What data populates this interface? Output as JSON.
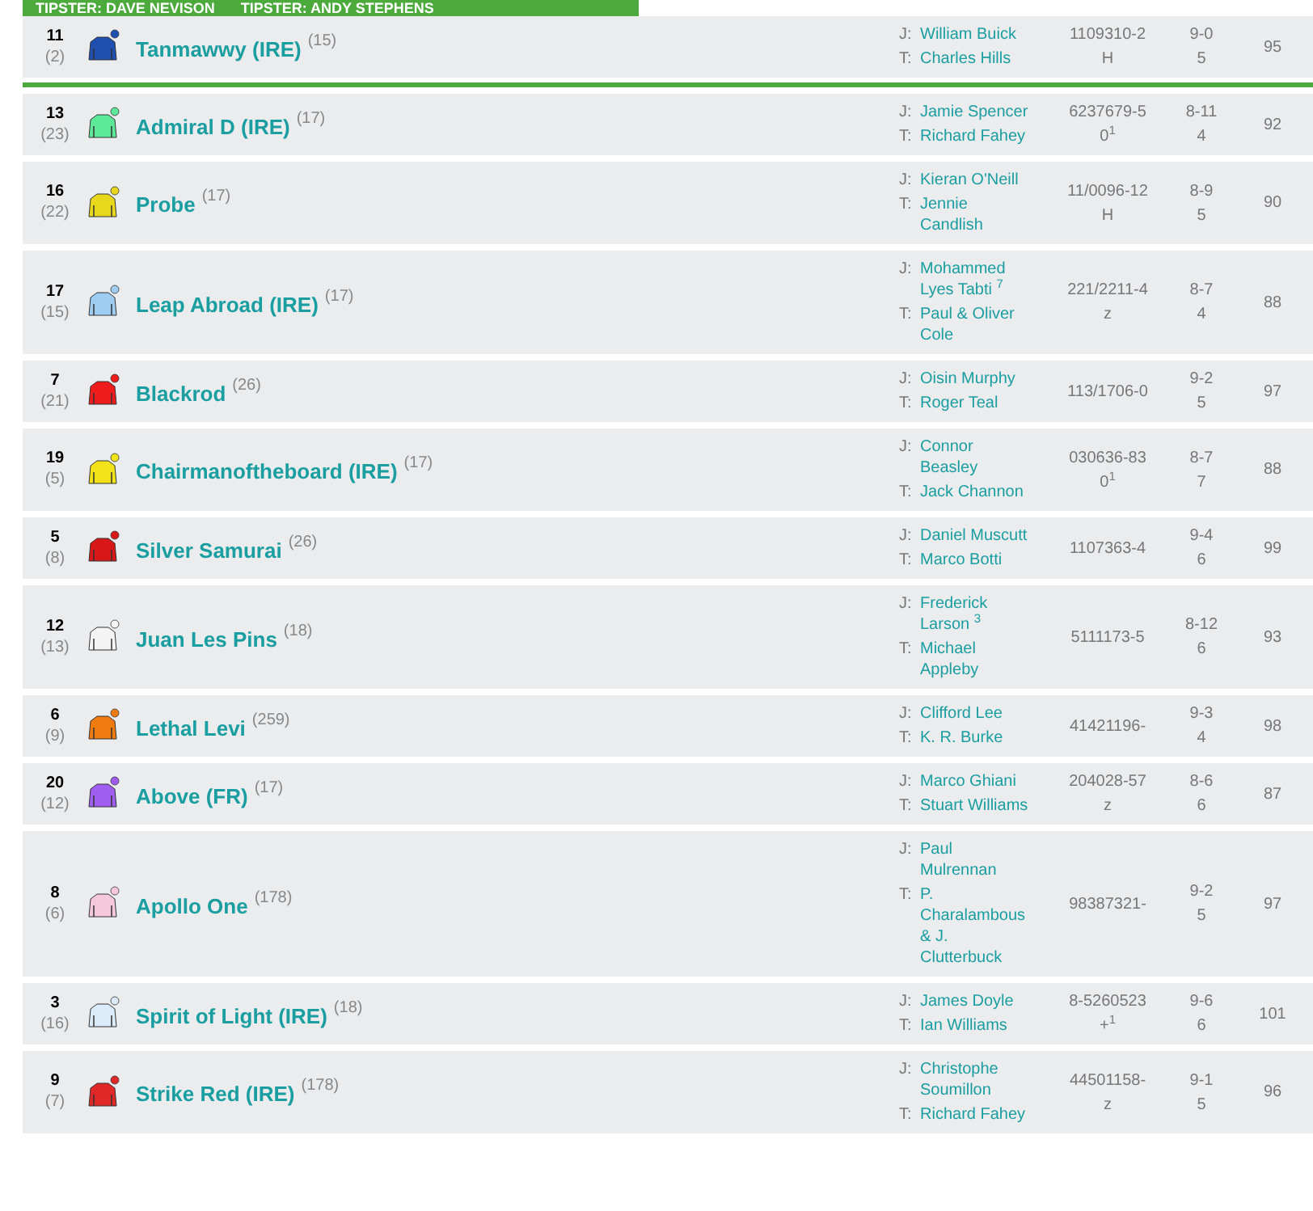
{
  "banner": {
    "tipsters": [
      "TIPSTER: DAVE NEVISON",
      "TIPSTER: ANDY STEPHENS"
    ]
  },
  "runners": [
    {
      "number": "11",
      "draw": "(2)",
      "name": "Tanmawwy (IRE)",
      "days": "(15)",
      "color": "#1f4fb0",
      "jockey_label": "J:",
      "jockey": "William Buick",
      "trainer_label": "T:",
      "trainer": "Charles Hills",
      "form": [
        "1109310-2",
        "H"
      ],
      "weight": "9-0",
      "age": "5",
      "rating": "95"
    },
    {
      "number": "13",
      "draw": "(23)",
      "name": "Admiral D (IRE)",
      "days": "(17)",
      "color": "#5ee89a",
      "jockey_label": "J:",
      "jockey": "Jamie Spencer",
      "trainer_label": "T:",
      "trainer": "Richard Fahey",
      "form": [
        "6237679-5",
        "0$^{1}$"
      ],
      "weight": "8-11",
      "age": "4",
      "rating": "92"
    },
    {
      "number": "16",
      "draw": "(22)",
      "name": "Probe",
      "days": "(17)",
      "color": "#e8d81c",
      "jockey_label": "J:",
      "jockey": "Kieran O'Neill",
      "trainer_label": "T:",
      "trainer": "Jennie Candlish",
      "form": [
        "11/0096-12",
        "H"
      ],
      "weight": "8-9",
      "age": "5",
      "rating": "90"
    },
    {
      "number": "17",
      "draw": "(15)",
      "name": "Leap Abroad (IRE)",
      "days": "(17)",
      "color": "#9fcdf2",
      "jockey_label": "J:",
      "jockey": "Mohammed Lyes Tabti $^{7}$",
      "trainer_label": "T:",
      "trainer": "Paul & Oliver Cole",
      "form": [
        "221/2211-4",
        "z"
      ],
      "weight": "8-7",
      "age": "4",
      "rating": "88"
    },
    {
      "number": "7",
      "draw": "(21)",
      "name": "Blackrod",
      "days": "(26)",
      "color": "#ee1c1c",
      "jockey_label": "J:",
      "jockey": "Oisin Murphy",
      "trainer_label": "T:",
      "trainer": "Roger Teal",
      "form": [
        "113/1706-0"
      ],
      "weight": "9-2",
      "age": "5",
      "rating": "97"
    },
    {
      "number": "19",
      "draw": "(5)",
      "name": "Chairmanoftheboard (IRE)",
      "days": "(17)",
      "color": "#f2e21a",
      "jockey_label": "J:",
      "jockey": "Connor Beasley",
      "trainer_label": "T:",
      "trainer": "Jack Channon",
      "form": [
        "030636-83",
        "0$^{1}$"
      ],
      "weight": "8-7",
      "age": "7",
      "rating": "88"
    },
    {
      "number": "5",
      "draw": "(8)",
      "name": "Silver Samurai",
      "days": "(26)",
      "color": "#d81818",
      "jockey_label": "J:",
      "jockey": "Daniel Muscutt",
      "trainer_label": "T:",
      "trainer": "Marco Botti",
      "form": [
        "1107363-4"
      ],
      "weight": "9-4",
      "age": "6",
      "rating": "99"
    },
    {
      "number": "12",
      "draw": "(13)",
      "name": "Juan Les Pins",
      "days": "(18)",
      "color": "#f4f4f4",
      "jockey_label": "J:",
      "jockey": "Frederick Larson $^{3}$",
      "trainer_label": "T:",
      "trainer": "Michael Appleby",
      "form": [
        "5111173-5"
      ],
      "weight": "8-12",
      "age": "6",
      "rating": "93"
    },
    {
      "number": "6",
      "draw": "(9)",
      "name": "Lethal Levi",
      "days": "(259)",
      "color": "#f07c10",
      "jockey_label": "J:",
      "jockey": "Clifford Lee",
      "trainer_label": "T:",
      "trainer": "K. R. Burke",
      "form": [
        "41421196-"
      ],
      "weight": "9-3",
      "age": "4",
      "rating": "98"
    },
    {
      "number": "20",
      "draw": "(12)",
      "name": "Above (FR)",
      "days": "(17)",
      "color": "#a05ef0",
      "jockey_label": "J:",
      "jockey": "Marco Ghiani",
      "trainer_label": "T:",
      "trainer": "Stuart Williams",
      "form": [
        "204028-57",
        "z"
      ],
      "weight": "8-6",
      "age": "6",
      "rating": "87"
    },
    {
      "number": "8",
      "draw": "(6)",
      "name": "Apollo One",
      "days": "(178)",
      "color": "#f6c8dc",
      "jockey_label": "J:",
      "jockey": "Paul Mulrennan",
      "trainer_label": "T:",
      "trainer": "P. Charalambous & J. Clutterbuck",
      "form": [
        "98387321-"
      ],
      "weight": "9-2",
      "age": "5",
      "rating": "97"
    },
    {
      "number": "3",
      "draw": "(16)",
      "name": "Spirit of Light (IRE)",
      "days": "(18)",
      "color": "#dcebfa",
      "jockey_label": "J:",
      "jockey": "James Doyle",
      "trainer_label": "T:",
      "trainer": "Ian Williams",
      "form": [
        "8-5260523",
        "+$^{1}$"
      ],
      "weight": "9-6",
      "age": "6",
      "rating": "101"
    },
    {
      "number": "9",
      "draw": "(7)",
      "name": "Strike Red (IRE)",
      "days": "(178)",
      "color": "#e02828",
      "jockey_label": "J:",
      "jockey": "Christophe Soumillon",
      "trainer_label": "T:",
      "trainer": "Richard Fahey",
      "form": [
        "44501158-",
        "z"
      ],
      "weight": "9-1",
      "age": "5",
      "rating": "96"
    }
  ]
}
